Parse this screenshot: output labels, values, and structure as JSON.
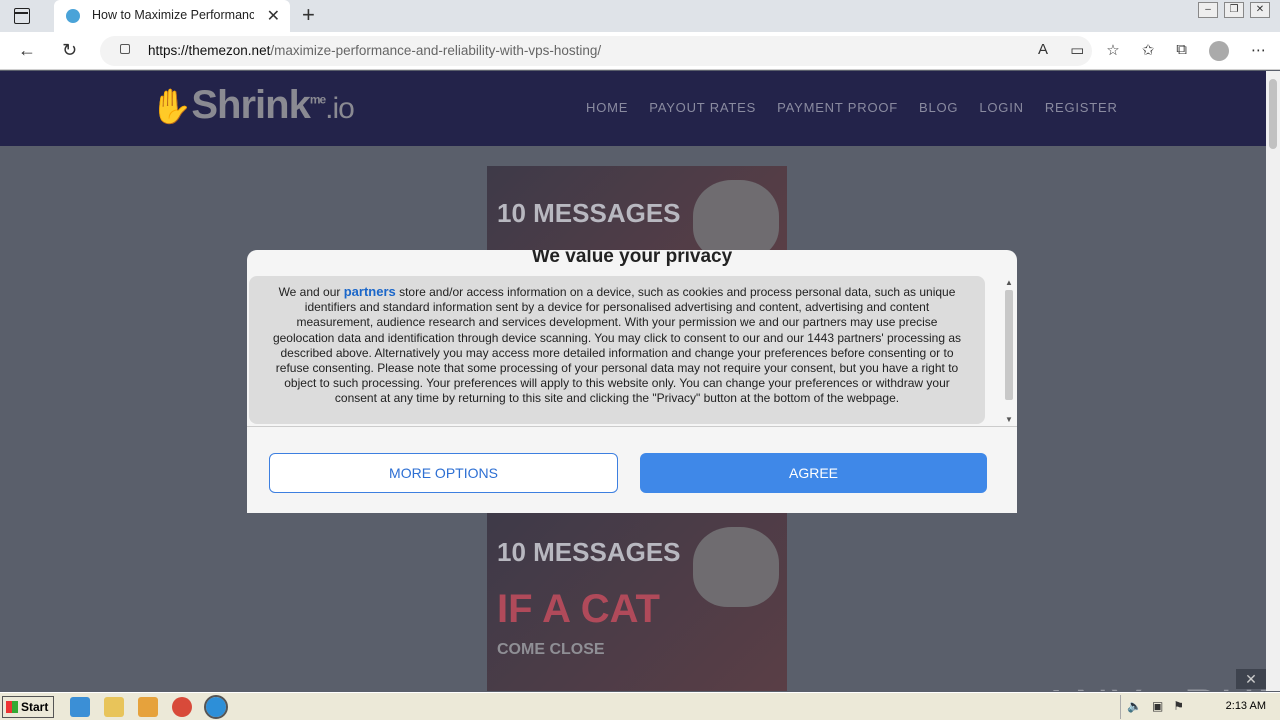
{
  "browser": {
    "tab_title": "How to Maximize Performance",
    "new_tab": "+",
    "tab_close": "✕",
    "url_domain": "https://themezon.net",
    "url_path": "/maximize-performance-and-reliability-with-vps-hosting/"
  },
  "site": {
    "logo_main": "Shrink",
    "logo_me": "me",
    "logo_io": ".io",
    "nav": [
      "HOME",
      "PAYOUT RATES",
      "PAYMENT PROOF",
      "BLOG",
      "LOGIN",
      "REGISTER"
    ]
  },
  "ads": {
    "headline": "10 MESSAGES",
    "line2": "IF A CAT",
    "line3": "COME CLOSE"
  },
  "consent": {
    "title": "We value your privacy",
    "text_before": "We and our ",
    "partners_link": "partners",
    "text_after": " store and/or access information on a device, such as cookies and process personal data, such as unique identifiers and standard information sent by a device for personalised advertising and content, advertising and content measurement, audience research and services development. With your permission we and our partners may use precise geolocation data and identification through device scanning. You may click to consent to our and our 1443 partners' processing as described above. Alternatively you may access more detailed information and change your preferences before consenting or to refuse consenting. Please note that some processing of your personal data may not require your consent, but you have a right to object to such processing. Your preferences will apply to this website only. You can change your preferences or withdraw your consent at any time by returning to this site and clicking the \"Privacy\" button at the bottom of the webpage.",
    "more_options": "MORE OPTIONS",
    "agree": "AGREE"
  },
  "watermark": "ANY▷RUN",
  "taskbar": {
    "start": "Start",
    "clock": "2:13 AM"
  },
  "colors": {
    "header_bg": "#23234a",
    "agree_bg": "#3f88e8",
    "link": "#1a66c9"
  }
}
